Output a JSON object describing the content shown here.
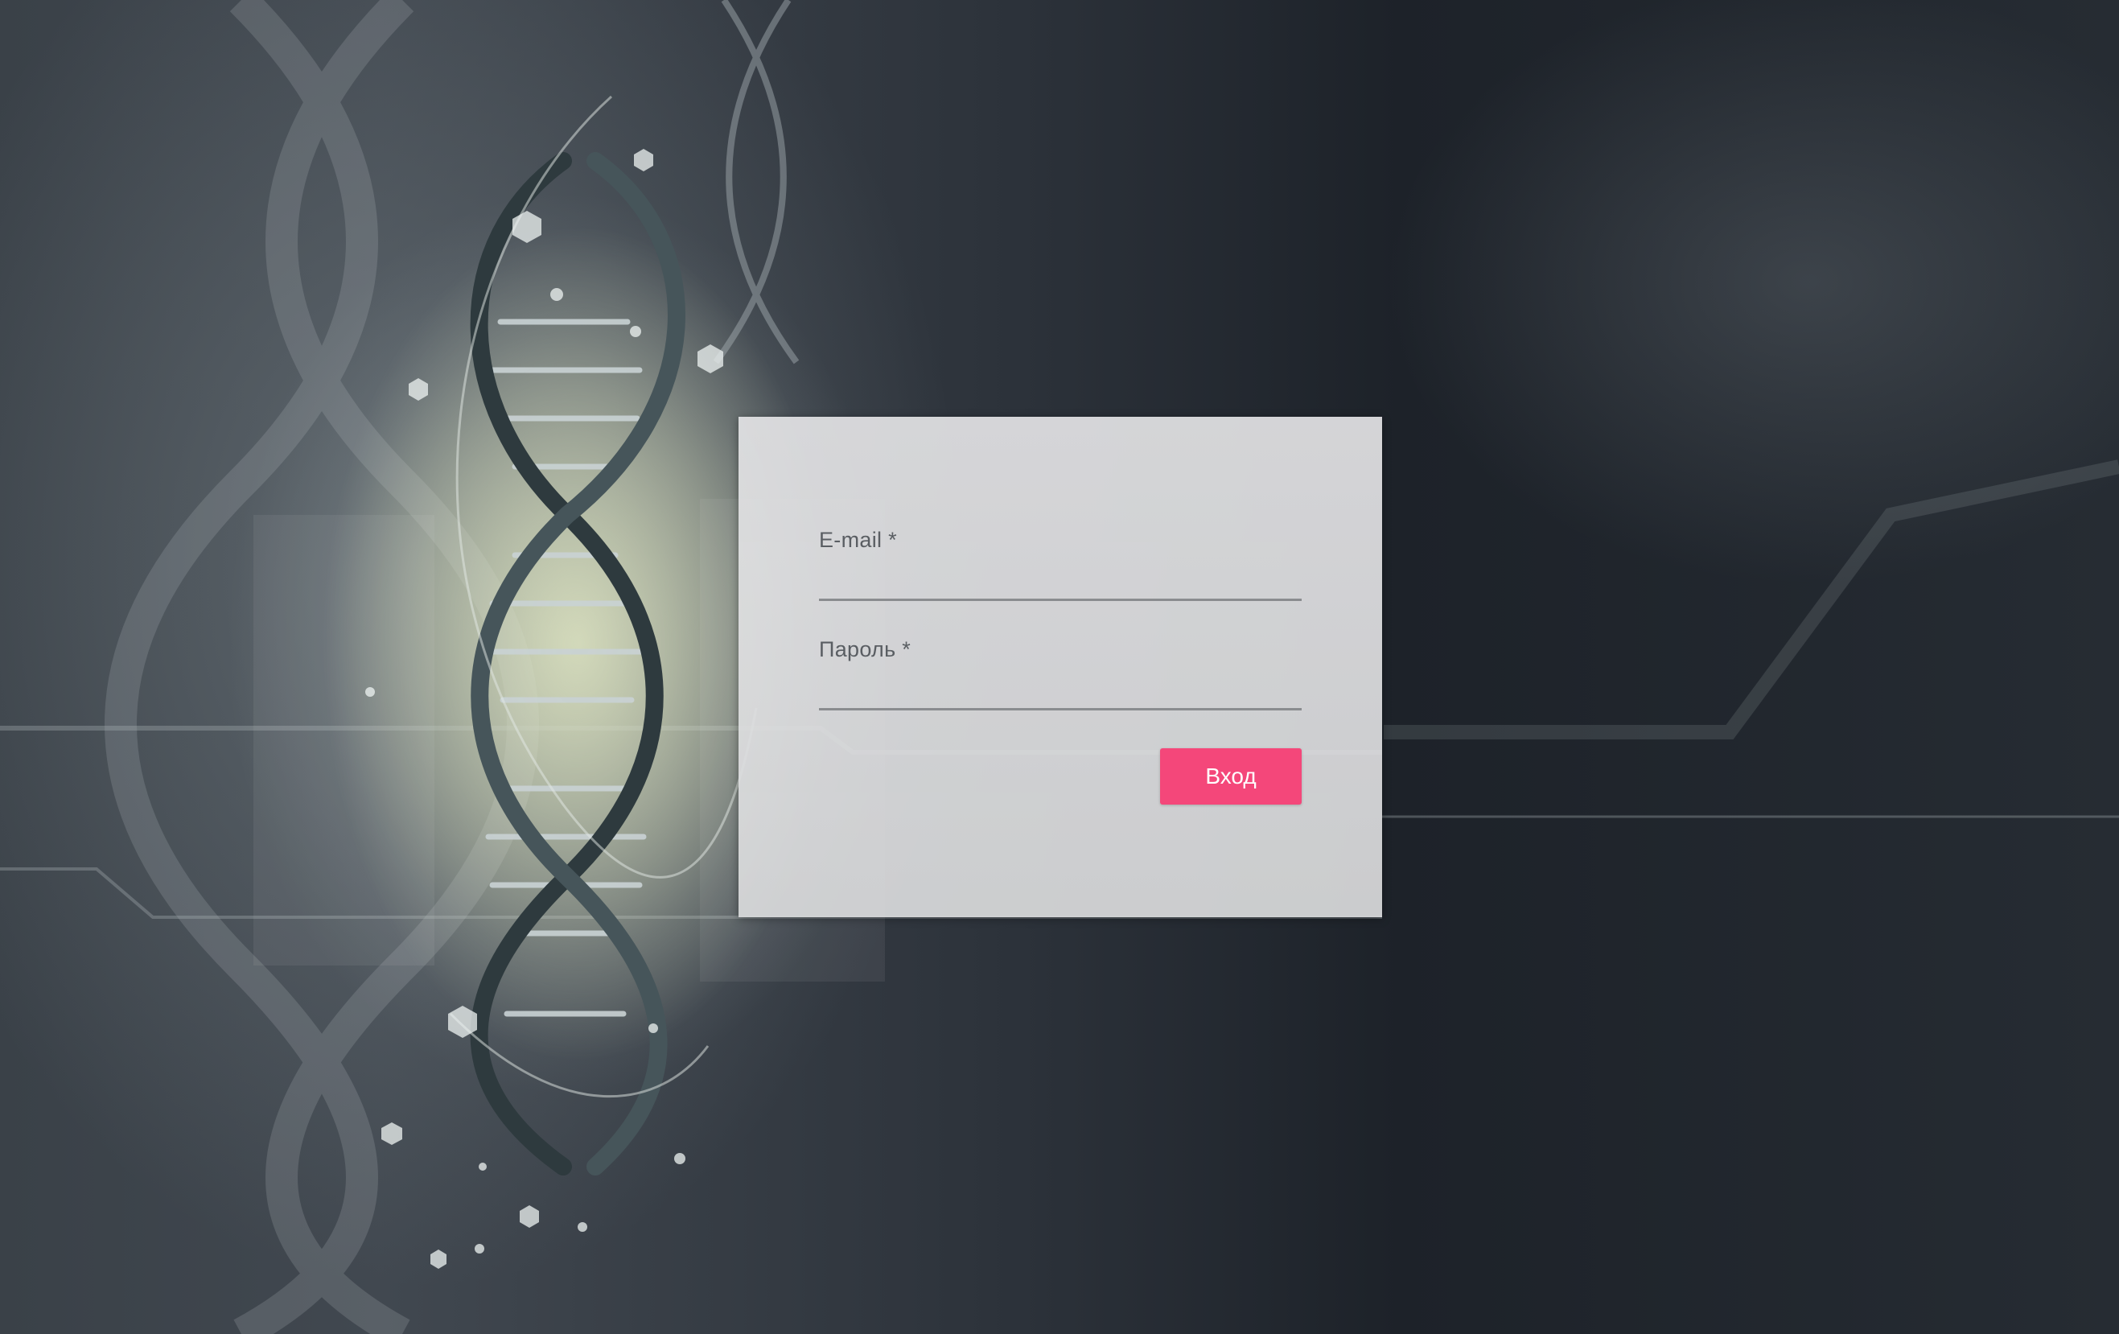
{
  "login_form": {
    "email_label": "E-mail *",
    "email_value": "",
    "password_label": "Пароль *",
    "password_value": "",
    "submit_label": "Вход"
  },
  "colors": {
    "accent": "#f4477a",
    "card_background": "#dcdcde",
    "underline": "#8a8c8f",
    "page_background": "#262c33"
  },
  "icons": [
    "dna-helix-illustration"
  ]
}
